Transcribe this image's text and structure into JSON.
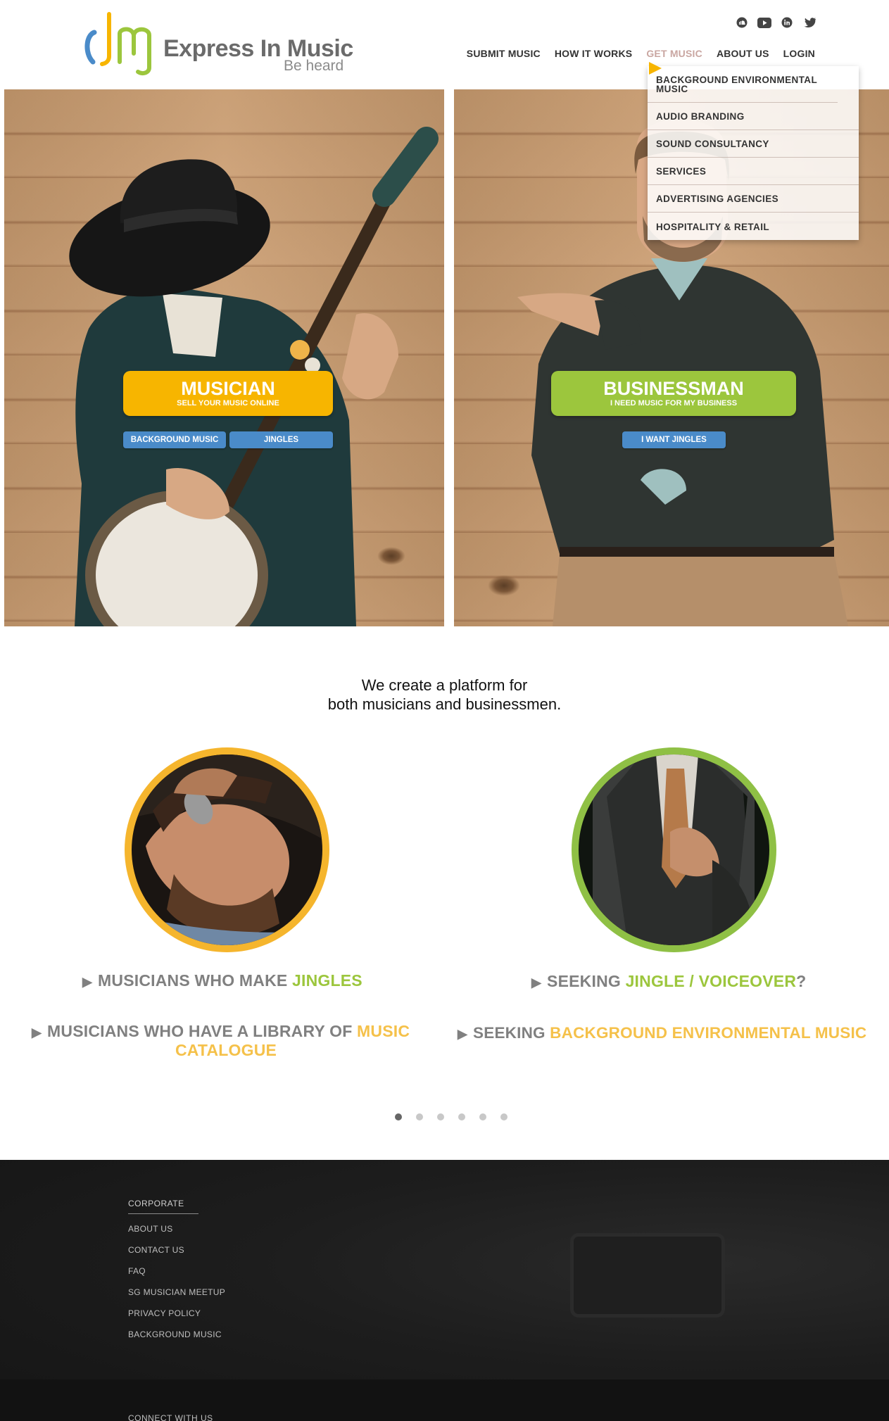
{
  "brand": {
    "name": "Express In Music",
    "tagline": "Be heard",
    "colors": {
      "blue": "#4a8bc9",
      "yellow": "#f7b500",
      "green": "#9cc63d",
      "gray": "#6b6b6b"
    }
  },
  "social": [
    "soundcloud-icon",
    "youtube-icon",
    "linkedin-icon",
    "twitter-icon"
  ],
  "nav": {
    "items": [
      {
        "label": "SUBMIT MUSIC"
      },
      {
        "label": "HOW IT WORKS"
      },
      {
        "label": "GET MUSIC"
      },
      {
        "label": "ABOUT US"
      },
      {
        "label": "LOGIN"
      }
    ]
  },
  "dropdown": {
    "items": [
      {
        "label": "BACKGROUND ENVIRONMENTAL MUSIC"
      },
      {
        "label": "AUDIO BRANDING"
      },
      {
        "label": "SOUND CONSULTANCY"
      },
      {
        "label": "SERVICES"
      },
      {
        "label": "ADVERTISING AGENCIES"
      },
      {
        "label": "HOSPITALITY & RETAIL"
      }
    ]
  },
  "hero": {
    "musician": {
      "title": "MUSICIAN",
      "subtitle": "SELL YOUR MUSIC ONLINE",
      "buttons": [
        "BACKGROUND MUSIC",
        "JINGLES"
      ]
    },
    "businessman": {
      "title": "BUSINESSMAN",
      "subtitle": "I NEED MUSIC FOR MY BUSINESS",
      "buttons": [
        "I WANT JINGLES"
      ]
    }
  },
  "platform": {
    "line1": "We create a platform for",
    "line2": "both musicians and businessmen."
  },
  "features": {
    "musician_1": {
      "prefix": "MUSICIANS WHO MAKE ",
      "highlight": "JINGLES"
    },
    "musician_2": {
      "prefix": "MUSICIANS WHO HAVE A LIBRARY OF ",
      "highlight_a": "MUSIC",
      "highlight_b": "CATALOGUE"
    },
    "business_1": {
      "prefix": "SEEKING ",
      "highlight": "JINGLE / VOICEOVER",
      "suffix": "?"
    },
    "business_2": {
      "prefix": "SEEKING ",
      "highlight": "BACKGROUND ENVIRONMENTAL MUSIC"
    }
  },
  "carousel": {
    "total": 6,
    "active": 1
  },
  "footer": {
    "heading": "CORPORATE",
    "links": [
      {
        "label": "ABOUT US"
      },
      {
        "label": "CONTACT US"
      },
      {
        "label": "FAQ"
      },
      {
        "label": "SG MUSICIAN MEETUP"
      },
      {
        "label": "PRIVACY POLICY"
      },
      {
        "label": "BACKGROUND MUSIC"
      }
    ],
    "connect": "CONNECT WITH US"
  }
}
